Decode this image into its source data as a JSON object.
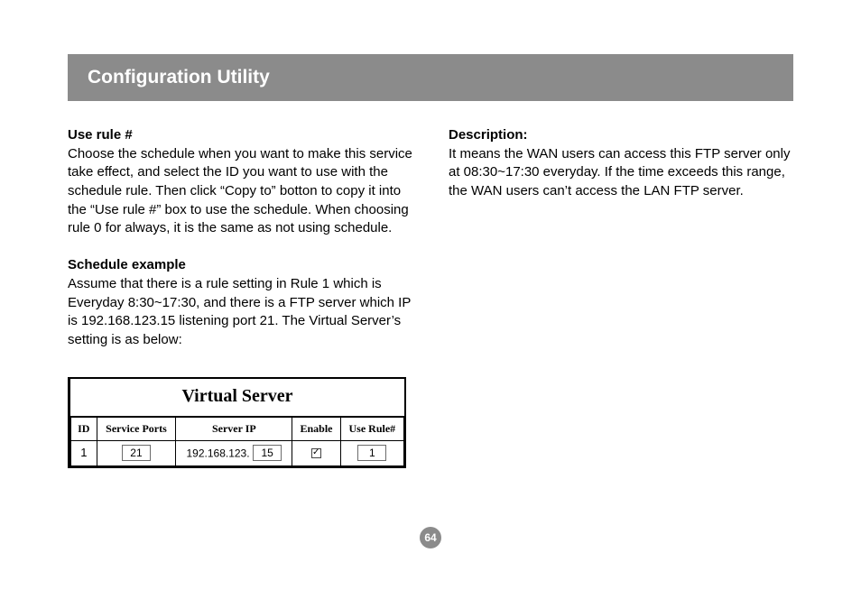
{
  "title_bar": "Configuration Utility",
  "left_col": {
    "section1": {
      "heading": "Use rule #",
      "body": "Choose the schedule when you want to make this service take effect, and select the ID you want to use with the schedule rule. Then click “Copy to” botton to copy it into the “Use rule #” box to use the schedule. When choosing rule 0 for always, it is the same as not using schedule."
    },
    "section2": {
      "heading": "Schedule example",
      "body": "Assume that there is a rule setting in Rule 1 which is Everyday 8:30~17:30, and there is a FTP server which IP is 192.168.123.15 listening port 21. The Virtual Server’s setting is as below:"
    }
  },
  "right_col": {
    "section1": {
      "heading": "Description:",
      "body": "It means the WAN users can access this FTP server only at 08:30~17:30 everyday. If the time exceeds this range, the WAN users can’t access the LAN FTP server."
    }
  },
  "virtual_server": {
    "title": "Virtual Server",
    "headers": {
      "id": "ID",
      "service_ports": "Service Ports",
      "server_ip": "Server IP",
      "enable": "Enable",
      "use_rule": "Use Rule#"
    },
    "row": {
      "id": "1",
      "service_ports": "21",
      "server_ip_prefix": "192.168.123.",
      "server_ip_suffix": "15",
      "enable_checked": true,
      "use_rule": "1"
    }
  },
  "page_number": "64"
}
